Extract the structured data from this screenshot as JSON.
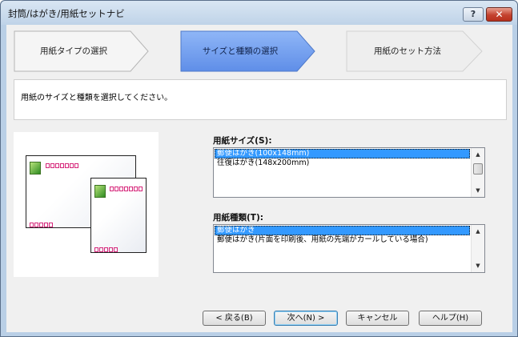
{
  "window": {
    "title": "封筒/はがき/用紙セットナビ",
    "help_button": "?",
    "close_button": "✕"
  },
  "steps": [
    {
      "label": "用紙タイプの選択",
      "active": false
    },
    {
      "label": "サイズと種類の選択",
      "active": true
    },
    {
      "label": "用紙のセット方法",
      "active": false
    }
  ],
  "instruction": "用紙のサイズと種類を選択してください。",
  "paper_size": {
    "label": "用紙サイズ(S):",
    "items": [
      {
        "text": "郵便はがき(100x148mm)",
        "selected": true
      },
      {
        "text": "往復はがき(148x200mm)",
        "selected": false
      }
    ]
  },
  "paper_type": {
    "label": "用紙種類(T):",
    "items": [
      {
        "text": "郵便はがき",
        "selected": true
      },
      {
        "text": "郵便はがき(片面を印刷後、用紙の先端がカールしている場合)",
        "selected": false
      }
    ]
  },
  "buttons": {
    "back": "< 戻る(B)",
    "next": "次へ(N) >",
    "cancel": "キャンセル",
    "help": "ヘルプ(H)"
  },
  "colors": {
    "active_step": "#6b9af0",
    "inactive_step": "#f3f3f3",
    "selection": "#3399ff",
    "postcard_stamp": "#2f8c22",
    "zip_boxes": "#d6267a"
  },
  "icons": {
    "scroll_up": "▲",
    "scroll_down": "▼"
  }
}
